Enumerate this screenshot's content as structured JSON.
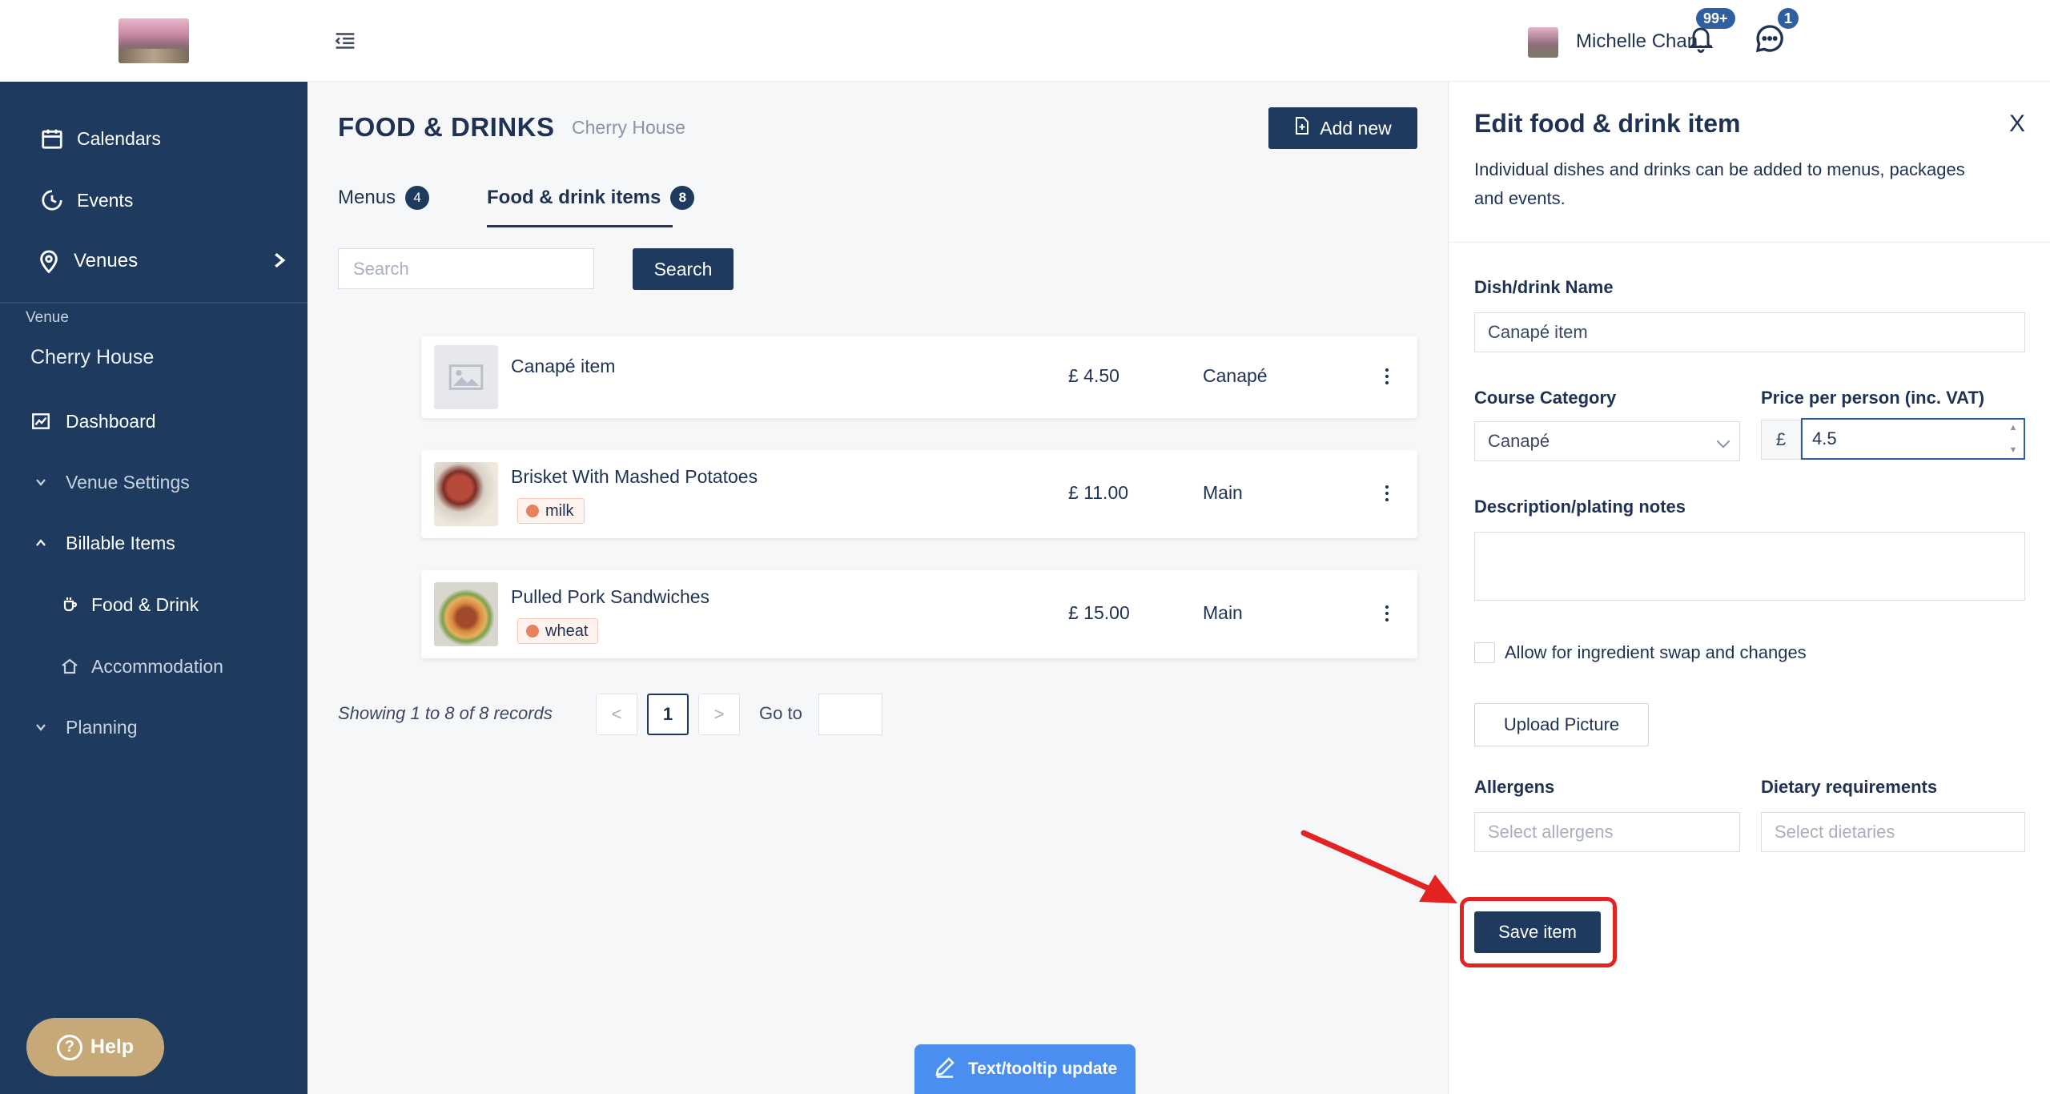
{
  "sidebar": {
    "items": [
      {
        "label": "Calendars",
        "icon": "calendar-icon"
      },
      {
        "label": "Events",
        "icon": "clock-icon"
      },
      {
        "label": "Venues",
        "icon": "location-pin-icon"
      }
    ],
    "section_label": "Venue",
    "venue_name": "Cherry House",
    "venue_items": [
      {
        "label": "Dashboard",
        "icon": "chart-icon"
      },
      {
        "label": "Venue Settings",
        "icon": "chevron-down-icon"
      },
      {
        "label": "Billable Items",
        "icon": "chevron-up-icon"
      },
      {
        "label": "Food & Drink",
        "icon": "cup-icon"
      },
      {
        "label": "Accommodation",
        "icon": "home-icon"
      },
      {
        "label": "Planning",
        "icon": "chevron-down-icon"
      }
    ],
    "help_label": "Help"
  },
  "topbar": {
    "notifications_badge": "99+",
    "messages_badge": "1",
    "user_name": "Michelle Chan..."
  },
  "page": {
    "title": "FOOD & DRINKS",
    "subtitle": "Cherry House",
    "add_new_label": "Add new",
    "tabs": [
      {
        "label": "Menus",
        "count": "4"
      },
      {
        "label": "Food & drink items",
        "count": "8"
      }
    ],
    "search_placeholder": "Search",
    "search_button": "Search"
  },
  "items": [
    {
      "name": "Canapé item",
      "price": "£ 4.50",
      "category": "Canapé",
      "tag": ""
    },
    {
      "name": "Brisket With Mashed Potatoes",
      "price": "£ 11.00",
      "category": "Main",
      "tag": "milk"
    },
    {
      "name": "Pulled Pork Sandwiches",
      "price": "£ 15.00",
      "category": "Main",
      "tag": "wheat"
    }
  ],
  "pagination": {
    "summary": "Showing 1 to 8 of 8 records",
    "prev": "<",
    "current": "1",
    "next": ">",
    "goto_label": "Go to"
  },
  "tooltip_update": "Text/tooltip update",
  "panel": {
    "title": "Edit food & drink item",
    "close": "X",
    "description": "Individual dishes and drinks can be added to menus, packages and events.",
    "name_label": "Dish/drink Name",
    "name_value": "Canapé item",
    "course_label": "Course Category",
    "course_value": "Canapé",
    "price_label": "Price per person (inc. VAT)",
    "currency": "£",
    "price_value": "4.5",
    "description_label": "Description/plating notes",
    "swap_label": "Allow for ingredient swap and changes",
    "upload_label": "Upload Picture",
    "allergens_label": "Allergens",
    "allergens_placeholder": "Select allergens",
    "dietary_label": "Dietary requirements",
    "dietary_placeholder": "Select dietaries",
    "save_label": "Save item"
  },
  "colors": {
    "sidebar": "#1e3a5f",
    "accent": "#1e3a5f",
    "highlight": "#e32222",
    "help": "#c7a878"
  }
}
